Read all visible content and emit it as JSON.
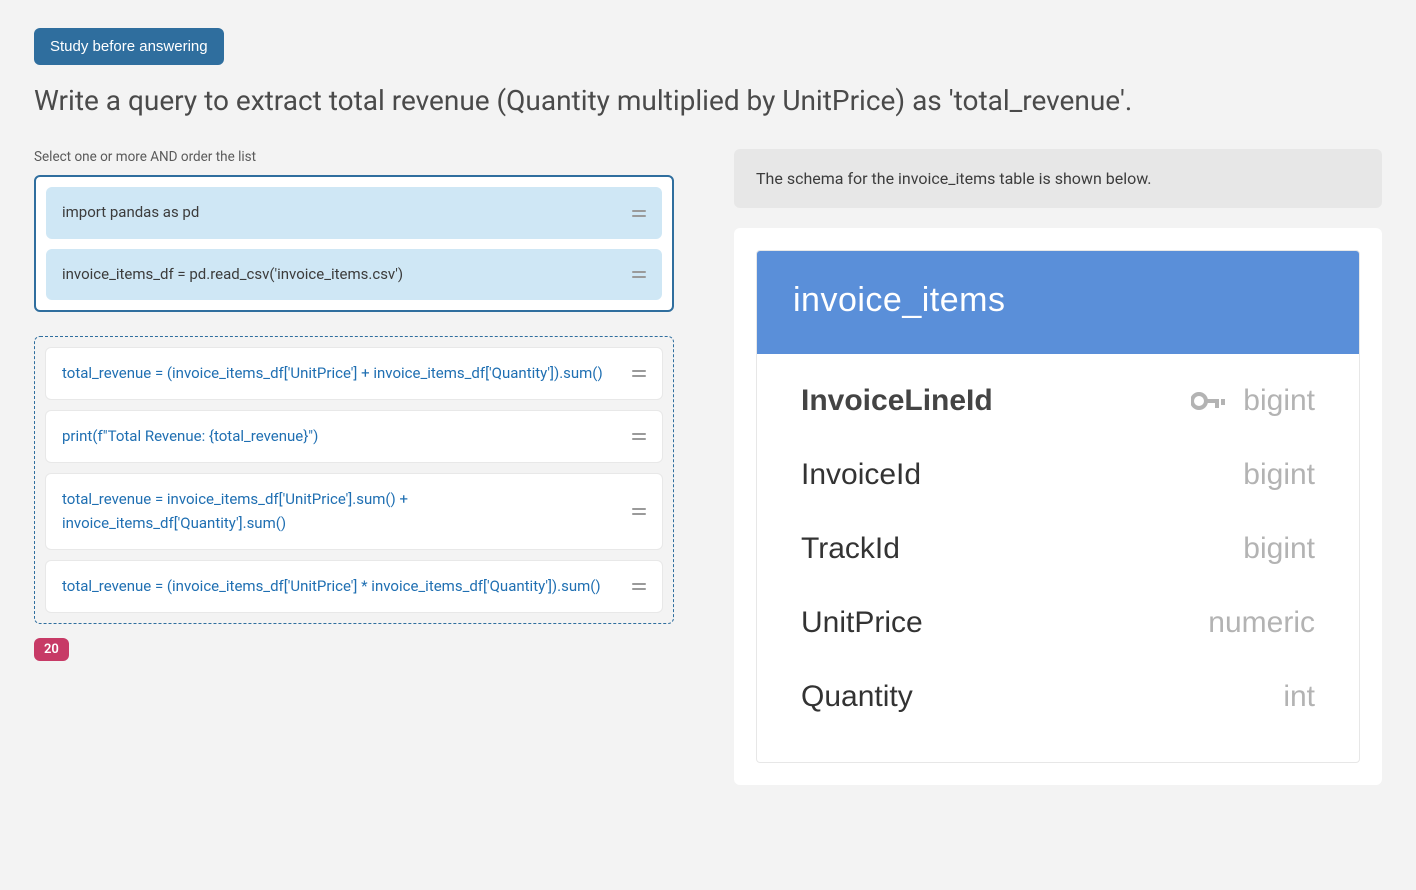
{
  "study_button_label": "Study before answering",
  "question_text": "Write a query to extract total revenue (Quantity multiplied by UnitPrice) as 'total_revenue'.",
  "instruction": "Select one or more AND order the list",
  "selected_options": [
    "import pandas as pd",
    "invoice_items_df = pd.read_csv('invoice_items.csv')"
  ],
  "available_options": [
    "total_revenue = (invoice_items_df['UnitPrice'] + invoice_items_df['Quantity']).sum()",
    "print(f\"Total Revenue: {total_revenue}\")",
    "total_revenue = invoice_items_df['UnitPrice'].sum() + invoice_items_df['Quantity'].sum()",
    "total_revenue = (invoice_items_df['UnitPrice'] * invoice_items_df['Quantity']).sum()"
  ],
  "score_badge": "20",
  "schema_note": "The schema for the invoice_items table is shown below.",
  "schema": {
    "table_name": "invoice_items",
    "columns": [
      {
        "name": "InvoiceLineId",
        "type": "bigint",
        "pk": true
      },
      {
        "name": "InvoiceId",
        "type": "bigint",
        "pk": false
      },
      {
        "name": "TrackId",
        "type": "bigint",
        "pk": false
      },
      {
        "name": "UnitPrice",
        "type": "numeric",
        "pk": false
      },
      {
        "name": "Quantity",
        "type": "int",
        "pk": false
      }
    ]
  }
}
